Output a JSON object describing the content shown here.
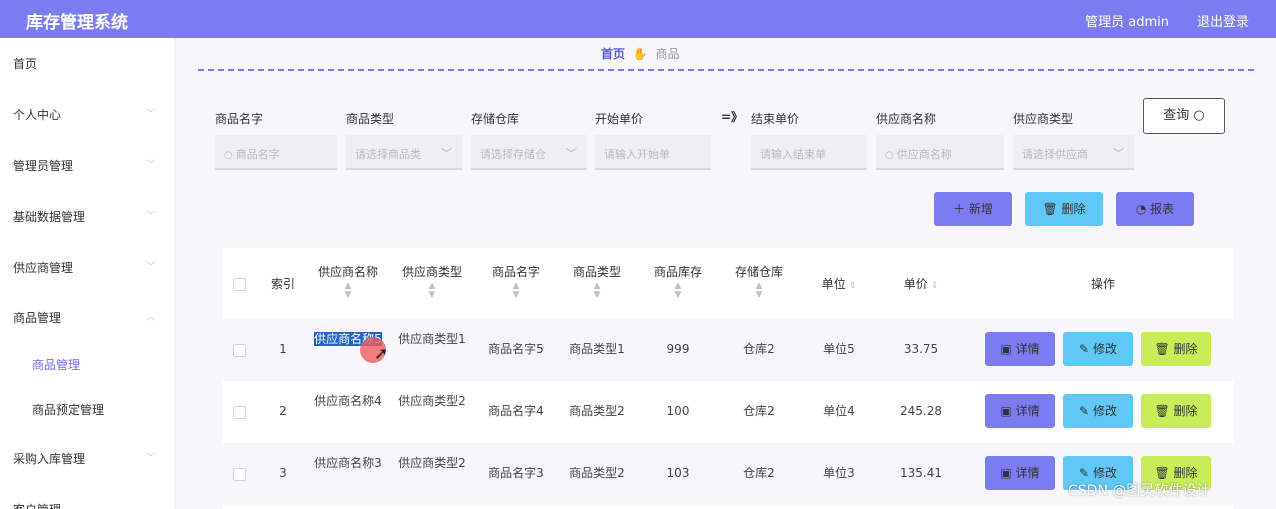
{
  "header": {
    "title": "库存管理系统",
    "user": "管理员 admin",
    "logout": "退出登录"
  },
  "sidebar": {
    "items": [
      {
        "label": "首页"
      },
      {
        "label": "个人中心"
      },
      {
        "label": "管理员管理"
      },
      {
        "label": "基础数据管理"
      },
      {
        "label": "供应商管理"
      },
      {
        "label": "商品管理"
      },
      {
        "label": "采购入库管理"
      },
      {
        "label": "客户管理"
      }
    ],
    "sub_items": [
      {
        "label": "商品管理",
        "active": true
      },
      {
        "label": "商品预定管理",
        "active": false
      }
    ]
  },
  "breadcrumb": {
    "home": "首页",
    "current": "商品"
  },
  "search": {
    "labels": [
      "商品名字",
      "商品类型",
      "存储仓库",
      "开始单价",
      "结束单价",
      "供应商名称",
      "供应商类型"
    ],
    "range_separator": "=》",
    "placeholders": [
      "商品名字",
      "请选择商品类",
      "请选择存储仓",
      "请输入开始单",
      "请输入结束单",
      "供应商名称",
      "请选择供应商"
    ],
    "query_button": "查询"
  },
  "actions": {
    "add": "新增",
    "delete": "删除",
    "report": "报表"
  },
  "table": {
    "headers": [
      "索引",
      "供应商名称",
      "供应商类型",
      "商品名字",
      "商品类型",
      "商品库存",
      "存储仓库",
      "单位",
      "单价",
      "操作"
    ],
    "rows": [
      {
        "index": "1",
        "supplier": "供应商名称5",
        "supplier_type": "供应商类型1",
        "name": "商品名字5",
        "type": "商品类型1",
        "stock": "999",
        "warehouse": "仓库2",
        "unit": "单位5",
        "price": "33.75"
      },
      {
        "index": "2",
        "supplier": "供应商名称4",
        "supplier_type": "供应商类型2",
        "name": "商品名字4",
        "type": "商品类型2",
        "stock": "100",
        "warehouse": "仓库2",
        "unit": "单位4",
        "price": "245.28"
      },
      {
        "index": "3",
        "supplier": "供应商名称3",
        "supplier_type": "供应商类型2",
        "name": "商品名字3",
        "type": "商品类型2",
        "stock": "103",
        "warehouse": "仓库2",
        "unit": "单位3",
        "price": "135.41"
      }
    ],
    "row_buttons": {
      "detail": "详情",
      "edit": "修改",
      "remove": "删除"
    }
  },
  "watermark": "CSDN @图灵软件设计",
  "colors": {
    "accent": "#7d7bf0",
    "info": "#5fc8f5",
    "lime": "#c8ec5a",
    "selection": "#2463cc"
  },
  "icons": [
    "search-icon",
    "chevron-down-icon",
    "plus-icon",
    "trash-icon",
    "chart-icon",
    "sort-icon",
    "detail-icon",
    "edit-icon",
    "hand-icon",
    "cursor-icon"
  ]
}
